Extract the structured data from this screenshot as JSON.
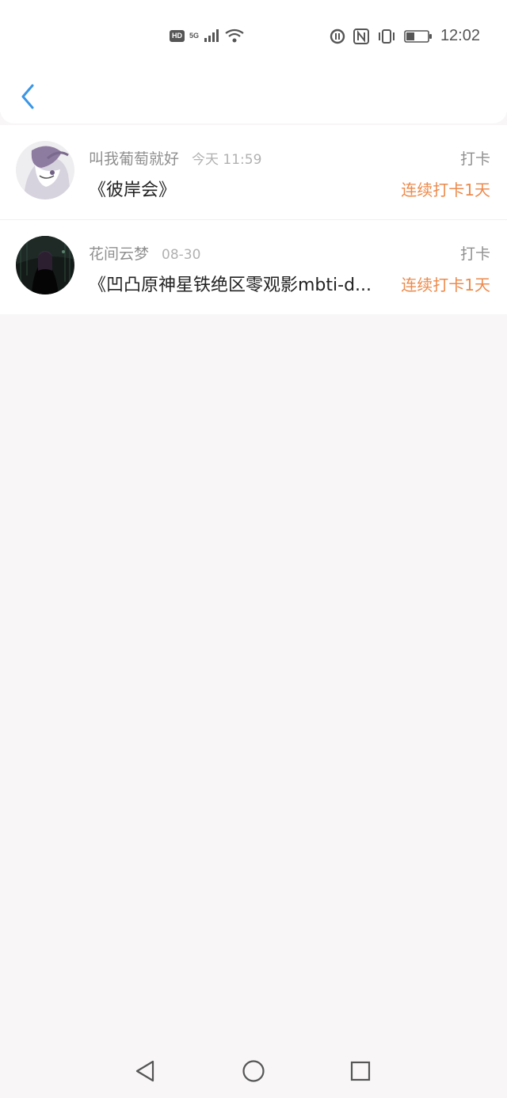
{
  "status_bar": {
    "hd": "HD",
    "network": "5G",
    "time": "12:02",
    "icons": [
      "hd-icon",
      "signal-icon",
      "wifi-icon",
      "data-saver-icon",
      "nfc-icon",
      "vibrate-icon",
      "battery-icon"
    ]
  },
  "nav": {
    "back_icon": "chevron-left-icon",
    "accent": "#3a96e6"
  },
  "list": [
    {
      "username": "叫我葡萄就好",
      "time": "今天 11:59",
      "type": "打卡",
      "title": "《彼岸会》",
      "streak": "连续打卡1天",
      "avatar": "avatar-anime-white"
    },
    {
      "username": "花间云梦",
      "time": "08-30",
      "type": "打卡",
      "title": "《凹凸原神星铁绝区零观影mbti-d...",
      "streak": "连续打卡1天",
      "avatar": "avatar-anime-dark"
    }
  ],
  "colors": {
    "streak": "#ec8a4b",
    "secondary_text": "#8f8f8f",
    "background": "#f8f6f7"
  },
  "system_nav": {
    "icons": [
      "back-triangle-icon",
      "home-circle-icon",
      "recents-square-icon"
    ]
  }
}
